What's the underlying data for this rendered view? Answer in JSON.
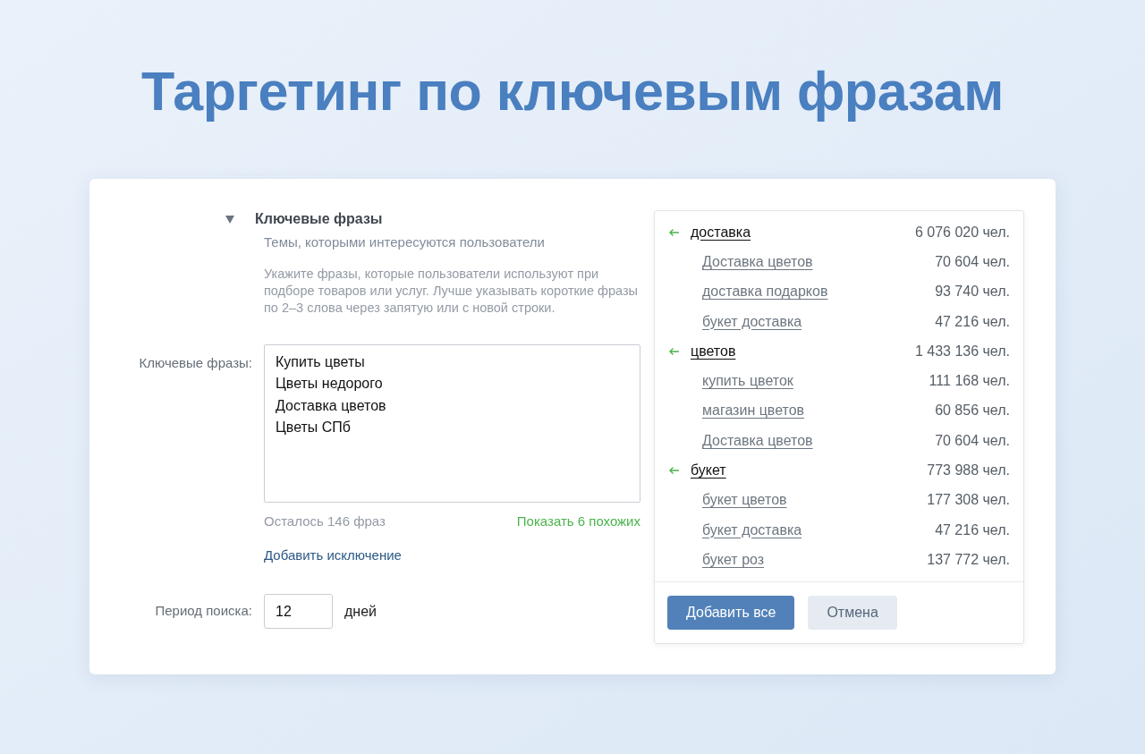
{
  "headline": "Таргетинг по ключевым фразам",
  "section": {
    "title": "Ключевые фразы",
    "expanded": true,
    "subtitle": "Темы, которыми интересуются пользователи",
    "description": "Укажите фразы, которые пользователи используют при подборе товаров или услуг. Лучше указывать короткие фразы по 2–3 слова через запятую или с новой строки."
  },
  "keywords": {
    "label": "Ключевые фразы:",
    "lines": [
      "Купить цветы",
      "Цветы недорого",
      "Доставка цветов",
      "Цветы СПб"
    ],
    "remaining": "Осталось 146 фраз",
    "show_similar": "Показать 6 похожих",
    "add_exclusion": "Добавить исключение"
  },
  "period": {
    "label": "Период поиска:",
    "value": "12",
    "unit": "дней"
  },
  "suggestions": {
    "groups": [
      {
        "word": "доставка",
        "count": "6 076 020 чел.",
        "children": [
          {
            "phrase": "Доставка цветов",
            "count": "70 604 чел."
          },
          {
            "phrase": "доставка подарков",
            "count": "93 740 чел."
          },
          {
            "phrase": "букет доставка",
            "count": "47 216 чел."
          }
        ]
      },
      {
        "word": "цветов",
        "count": "1 433 136 чел.",
        "children": [
          {
            "phrase": "купить цветок",
            "count": "111 168 чел."
          },
          {
            "phrase": "магазин цветов",
            "count": "60 856 чел."
          },
          {
            "phrase": "Доставка цветов",
            "count": "70 604 чел."
          }
        ]
      },
      {
        "word": "букет",
        "count": "773 988 чел.",
        "children": [
          {
            "phrase": "букет цветов",
            "count": "177 308 чел."
          },
          {
            "phrase": "букет доставка",
            "count": "47 216 чел."
          },
          {
            "phrase": "букет роз",
            "count": "137 772 чел."
          }
        ]
      }
    ],
    "buttons": [
      {
        "label": "Добавить все",
        "kind": "primary"
      },
      {
        "label": "Отмена",
        "kind": "secondary"
      }
    ]
  }
}
